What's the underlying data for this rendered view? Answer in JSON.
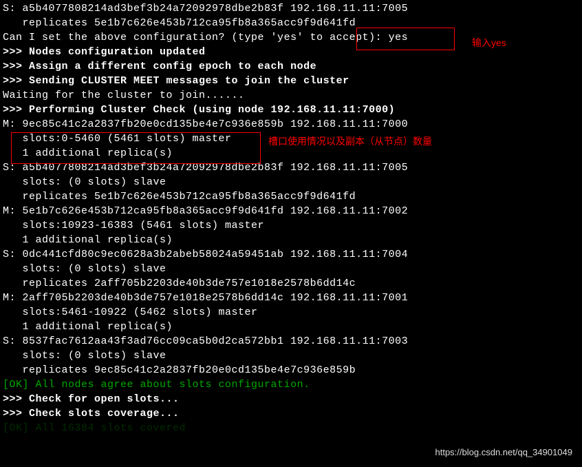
{
  "lines": {
    "l0": "S: a5b4077808214ad3bef3b24a72092978dbe2b83f 192.168.11.11:7005",
    "l1": "   replicates 5e1b7c626e453b712ca95fb8a365acc9f9d641fd",
    "l2": "Can I set the above configuration? (type 'yes' to accept): yes",
    "l3": ">>> Nodes configuration updated",
    "l4": ">>> Assign a different config epoch to each node",
    "l5": ">>> Sending CLUSTER MEET messages to join the cluster",
    "l6": "Waiting for the cluster to join......",
    "l7": ">>> Performing Cluster Check (using node 192.168.11.11:7000)",
    "l8": "M: 9ec85c41c2a2837fb20e0cd135be4e7c936e859b 192.168.11.11:7000",
    "l9": "   slots:0-5460 (5461 slots) master",
    "l10": "   1 additional replica(s)",
    "l11": "S: a5b4077808214ad3bef3b24a72092978dbe2b83f 192.168.11.11:7005",
    "l12": "   slots: (0 slots) slave",
    "l13": "   replicates 5e1b7c626e453b712ca95fb8a365acc9f9d641fd",
    "l14": "M: 5e1b7c626e453b712ca95fb8a365acc9f9d641fd 192.168.11.11:7002",
    "l15": "   slots:10923-16383 (5461 slots) master",
    "l16": "   1 additional replica(s)",
    "l17": "S: 0dc441cfd80c9ec0628a3b2abeb58024a59451ab 192.168.11.11:7004",
    "l18": "   slots: (0 slots) slave",
    "l19": "   replicates 2aff705b2203de40b3de757e1018e2578b6dd14c",
    "l20": "M: 2aff705b2203de40b3de757e1018e2578b6dd14c 192.168.11.11:7001",
    "l21": "   slots:5461-10922 (5462 slots) master",
    "l22": "   1 additional replica(s)",
    "l23": "S: 8537fac7612aa43f3ad76cc09ca5b0d2ca572bb1 192.168.11.11:7003",
    "l24": "   slots: (0 slots) slave",
    "l25": "   replicates 9ec85c41c2a2837fb20e0cd135be4e7c936e859b",
    "l26": "[OK] All nodes agree about slots configuration.",
    "l27": ">>> Check for open slots...",
    "l28": ">>> Check slots coverage...",
    "l29": "[OK] All 16384 slots covered"
  },
  "annot": {
    "a1": "输入yes",
    "a2": "槽口使用情况以及副本（从节点）数量"
  },
  "watermark": "https://blog.csdn.net/qq_34901049"
}
